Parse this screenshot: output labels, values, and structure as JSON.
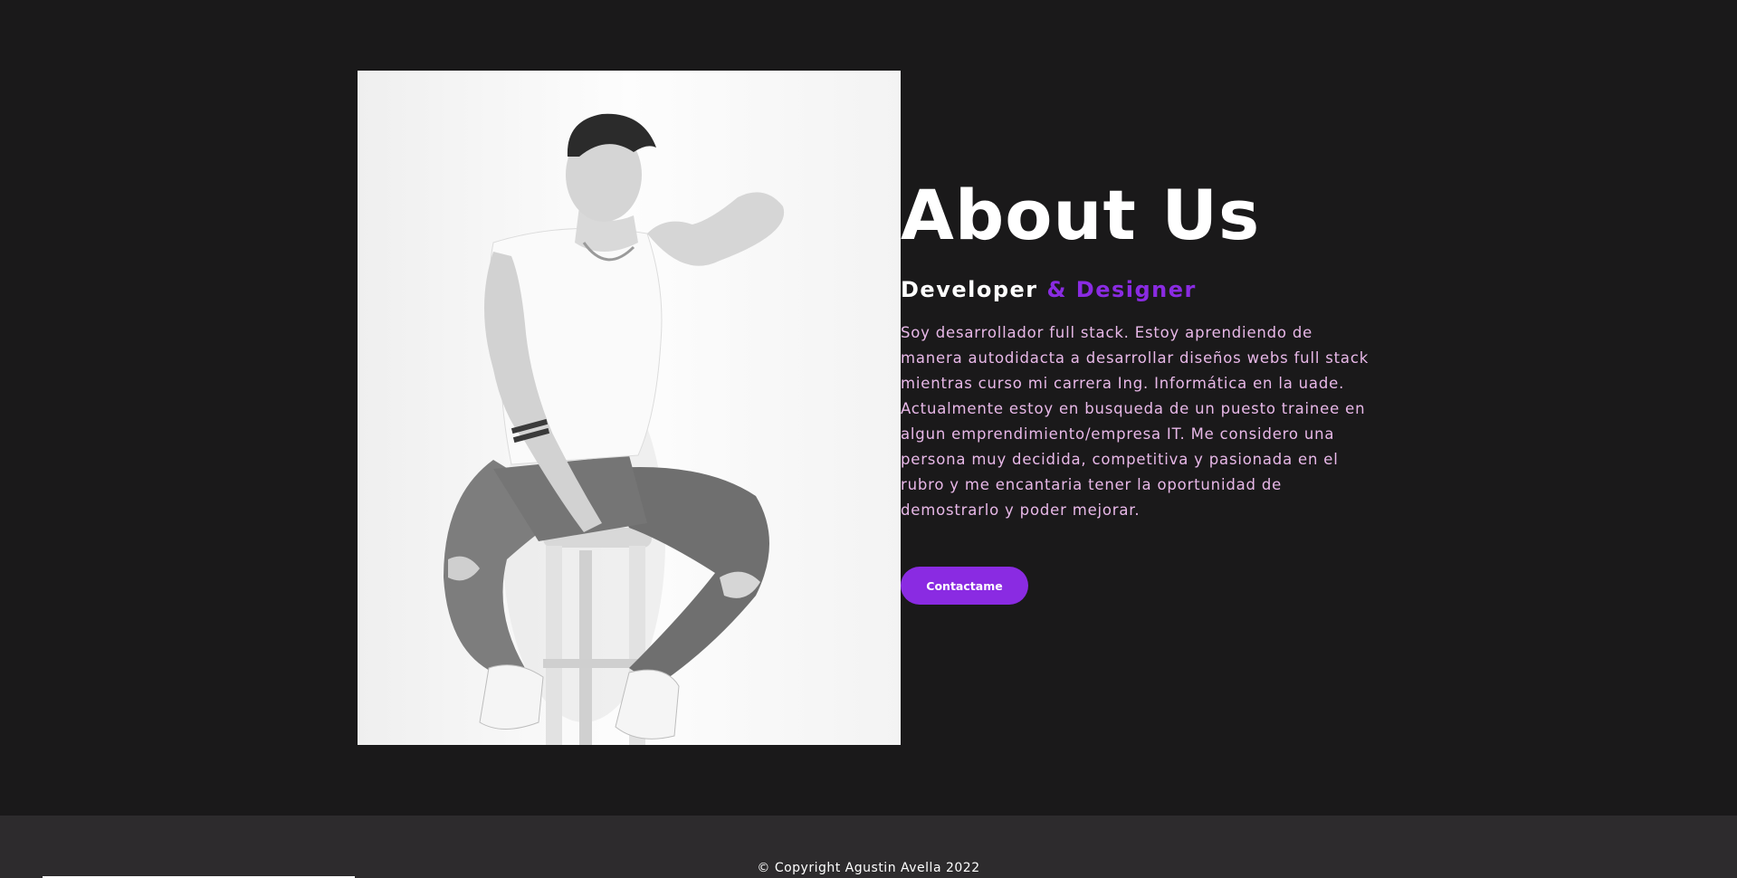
{
  "about": {
    "title": "About Us",
    "subtitle_main": "Developer ",
    "subtitle_accent": "& Designer",
    "paragraph": "Soy desarrollador full stack. Estoy aprendiendo de manera autodidacta a desarrollar diseños webs full stack mientras curso mi carrera Ing. Informática en la uade. Actualmente estoy en busqueda de un puesto trainee en algun emprendimiento/empresa IT. Me considero una persona muy decidida, competitiva y pasionada en el rubro y me encantaria tener la oportunidad de demostrarlo y poder mejorar.",
    "button_label": "Contactame"
  },
  "footer": {
    "copyright": "© Copyright Agustin Avella 2022"
  },
  "colors": {
    "background": "#1a191a",
    "accent": "#8a2be2",
    "paragraph_text": "#e8b8e8",
    "footer_background": "#2d2b2d"
  }
}
